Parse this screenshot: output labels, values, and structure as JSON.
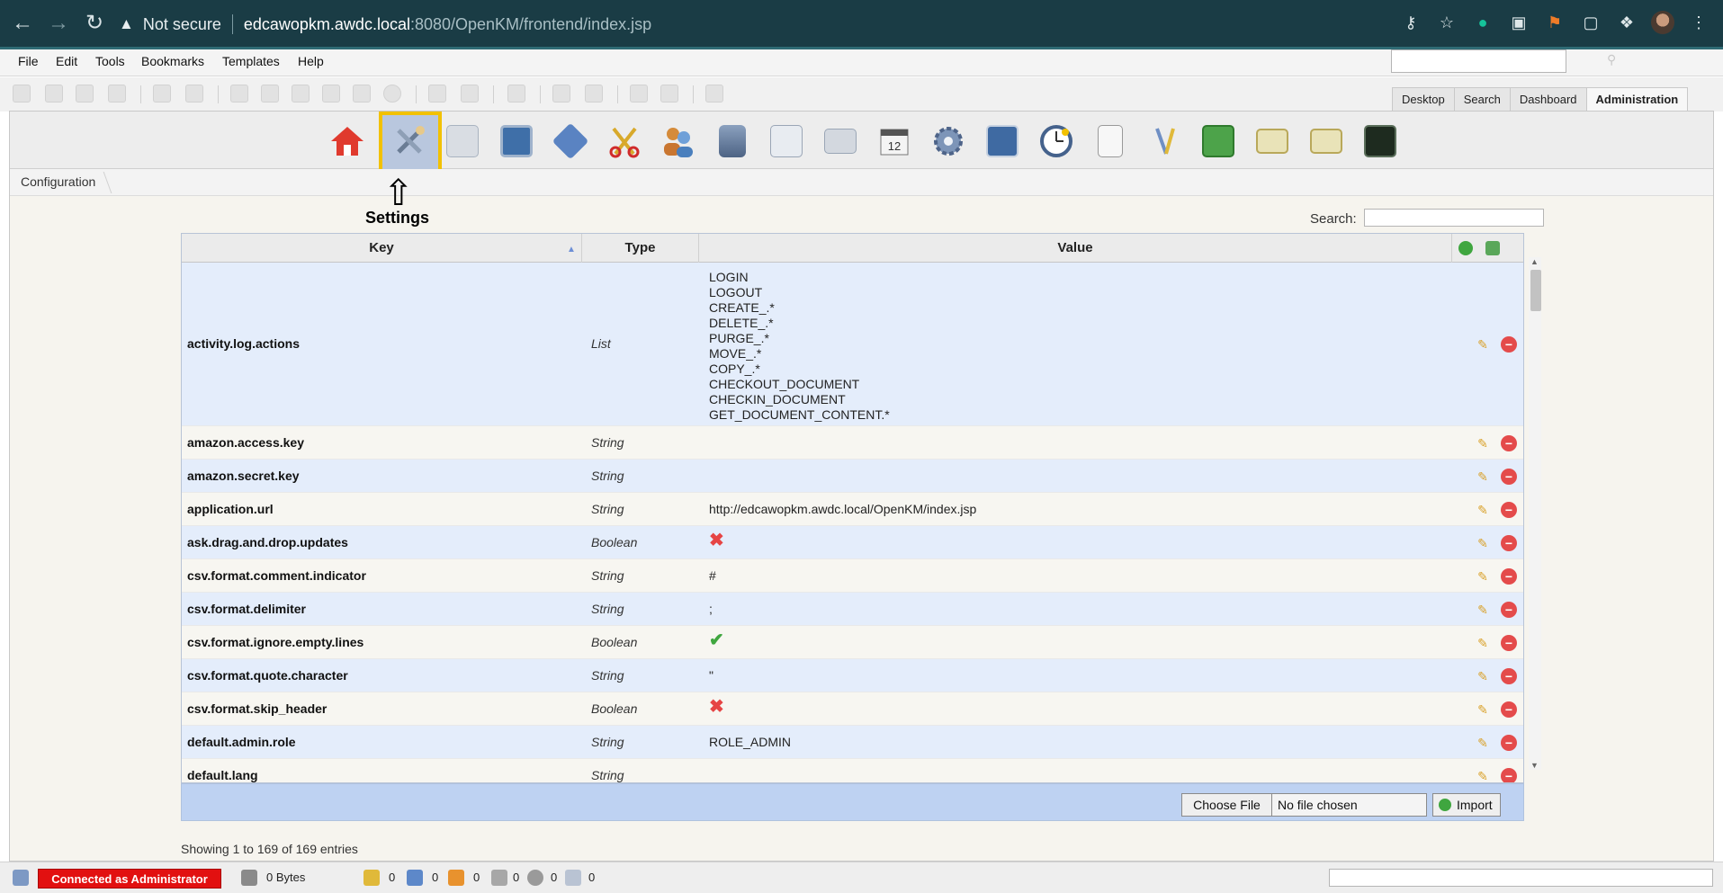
{
  "browser": {
    "security_label": "Not secure",
    "url_host": "edcawopkm.awdc.local",
    "url_path": ":8080/OpenKM/frontend/index.jsp"
  },
  "menu": [
    "File",
    "Edit",
    "Tools",
    "Bookmarks",
    "Templates",
    "Help"
  ],
  "top_tabs": [
    {
      "label": "Desktop",
      "active": false
    },
    {
      "label": "Search",
      "active": false
    },
    {
      "label": "Dashboard",
      "active": false
    },
    {
      "label": "Administration",
      "active": true
    }
  ],
  "admin_icons": [
    "home-icon",
    "settings-icon",
    "search-icon",
    "monitor-icon",
    "diamond-icon",
    "scissors-icon",
    "users-icon",
    "database-icon",
    "zoom-icon",
    "printer-icon",
    "calendar-icon",
    "gear-icon",
    "network-icon",
    "clock-icon",
    "list-icon",
    "brush-icon",
    "stack-icon",
    "import-icon",
    "export-icon",
    "terminal-icon"
  ],
  "breadcrumb": "Configuration",
  "annotation": {
    "label": "Settings"
  },
  "search_label": "Search:",
  "table": {
    "columns": {
      "key": "Key",
      "type": "Type",
      "value": "Value"
    },
    "rows": [
      {
        "key": "activity.log.actions",
        "type": "List",
        "value_lines": [
          "LOGIN",
          "LOGOUT",
          "CREATE_.*",
          "DELETE_.*",
          "PURGE_.*",
          "MOVE_.*",
          "COPY_.*",
          "CHECKOUT_DOCUMENT",
          "CHECKIN_DOCUMENT",
          "GET_DOCUMENT_CONTENT.*"
        ]
      },
      {
        "key": "amazon.access.key",
        "type": "String",
        "value": ""
      },
      {
        "key": "amazon.secret.key",
        "type": "String",
        "value": ""
      },
      {
        "key": "application.url",
        "type": "String",
        "value": "http://edcawopkm.awdc.local/OpenKM/index.jsp"
      },
      {
        "key": "ask.drag.and.drop.updates",
        "type": "Boolean",
        "bool": false
      },
      {
        "key": "csv.format.comment.indicator",
        "type": "String",
        "value": "#"
      },
      {
        "key": "csv.format.delimiter",
        "type": "String",
        "value": ";"
      },
      {
        "key": "csv.format.ignore.empty.lines",
        "type": "Boolean",
        "bool": true
      },
      {
        "key": "csv.format.quote.character",
        "type": "String",
        "value": "\""
      },
      {
        "key": "csv.format.skip_header",
        "type": "Boolean",
        "bool": false
      },
      {
        "key": "default.admin.role",
        "type": "String",
        "value": "ROLE_ADMIN"
      },
      {
        "key": "default.lang",
        "type": "String",
        "value": ""
      }
    ]
  },
  "import": {
    "choose_file": "Choose File",
    "no_file": "No file chosen",
    "import_label": "Import"
  },
  "showing": "Showing 1 to 169 of 169 entries",
  "status": {
    "connected": "Connected as Administrator",
    "size": "0 Bytes",
    "counts": [
      "0",
      "0",
      "0",
      "0",
      "0",
      "0"
    ]
  },
  "colors": {
    "browser_bar": "#1a3c45",
    "selected_border": "#f2c100",
    "row_odd": "#e4edfb",
    "connected_badge": "#e21010"
  }
}
